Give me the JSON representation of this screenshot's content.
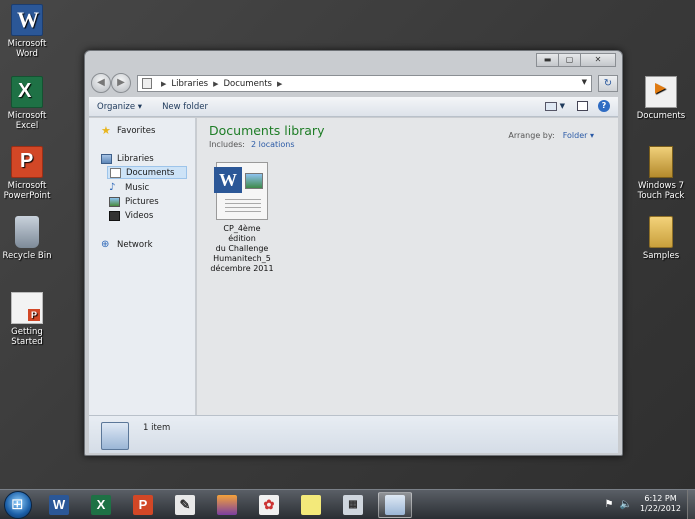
{
  "desktop": {
    "left_icons": [
      {
        "label_line1": "Microsoft",
        "label_line2": "Word",
        "icon": "word-icon"
      },
      {
        "label_line1": "Microsoft",
        "label_line2": "Excel",
        "icon": "excel-icon"
      },
      {
        "label_line1": "Microsoft",
        "label_line2": "PowerPoint",
        "icon": "powerpoint-icon"
      },
      {
        "label_line1": "Recycle Bin",
        "label_line2": "",
        "icon": "recycle-bin-icon"
      },
      {
        "label_line1": "Getting",
        "label_line2": "Started",
        "icon": "getting-started-icon"
      }
    ],
    "right_icons": [
      {
        "label_line1": "Documents",
        "label_line2": "",
        "icon": "documents-icon"
      },
      {
        "label_line1": "Windows 7",
        "label_line2": "Touch Pack",
        "icon": "touch-pack-icon"
      },
      {
        "label_line1": "Samples",
        "label_line2": "",
        "icon": "folder-icon"
      }
    ]
  },
  "window": {
    "address": {
      "crumbs": [
        "Libraries",
        "Documents"
      ]
    },
    "toolbar": {
      "organize": "Organize ▾",
      "new_folder": "New folder"
    },
    "nav": {
      "favorites": "Favorites",
      "libraries": "Libraries",
      "documents": "Documents",
      "music": "Music",
      "pictures": "Pictures",
      "videos": "Videos",
      "network": "Network"
    },
    "content": {
      "title": "Documents library",
      "includes_label": "Includes:",
      "includes_link": "2 locations",
      "arrange_label": "Arrange by:",
      "arrange_value": "Folder ▾",
      "file": {
        "line1": "CP_4ème édition",
        "line2": "du Challenge",
        "line3": "Humanitech_5",
        "line4": "décembre 2011"
      }
    },
    "details": {
      "count": "1 item"
    }
  },
  "taskbar": {
    "time": "6:12 PM",
    "date": "1/22/2012"
  },
  "colors": {
    "library_title": "#1e7d26",
    "link": "#2a5aa6",
    "word_blue": "#2b5797",
    "excel_green": "#1e7145",
    "powerpoint_orange": "#d24726"
  }
}
